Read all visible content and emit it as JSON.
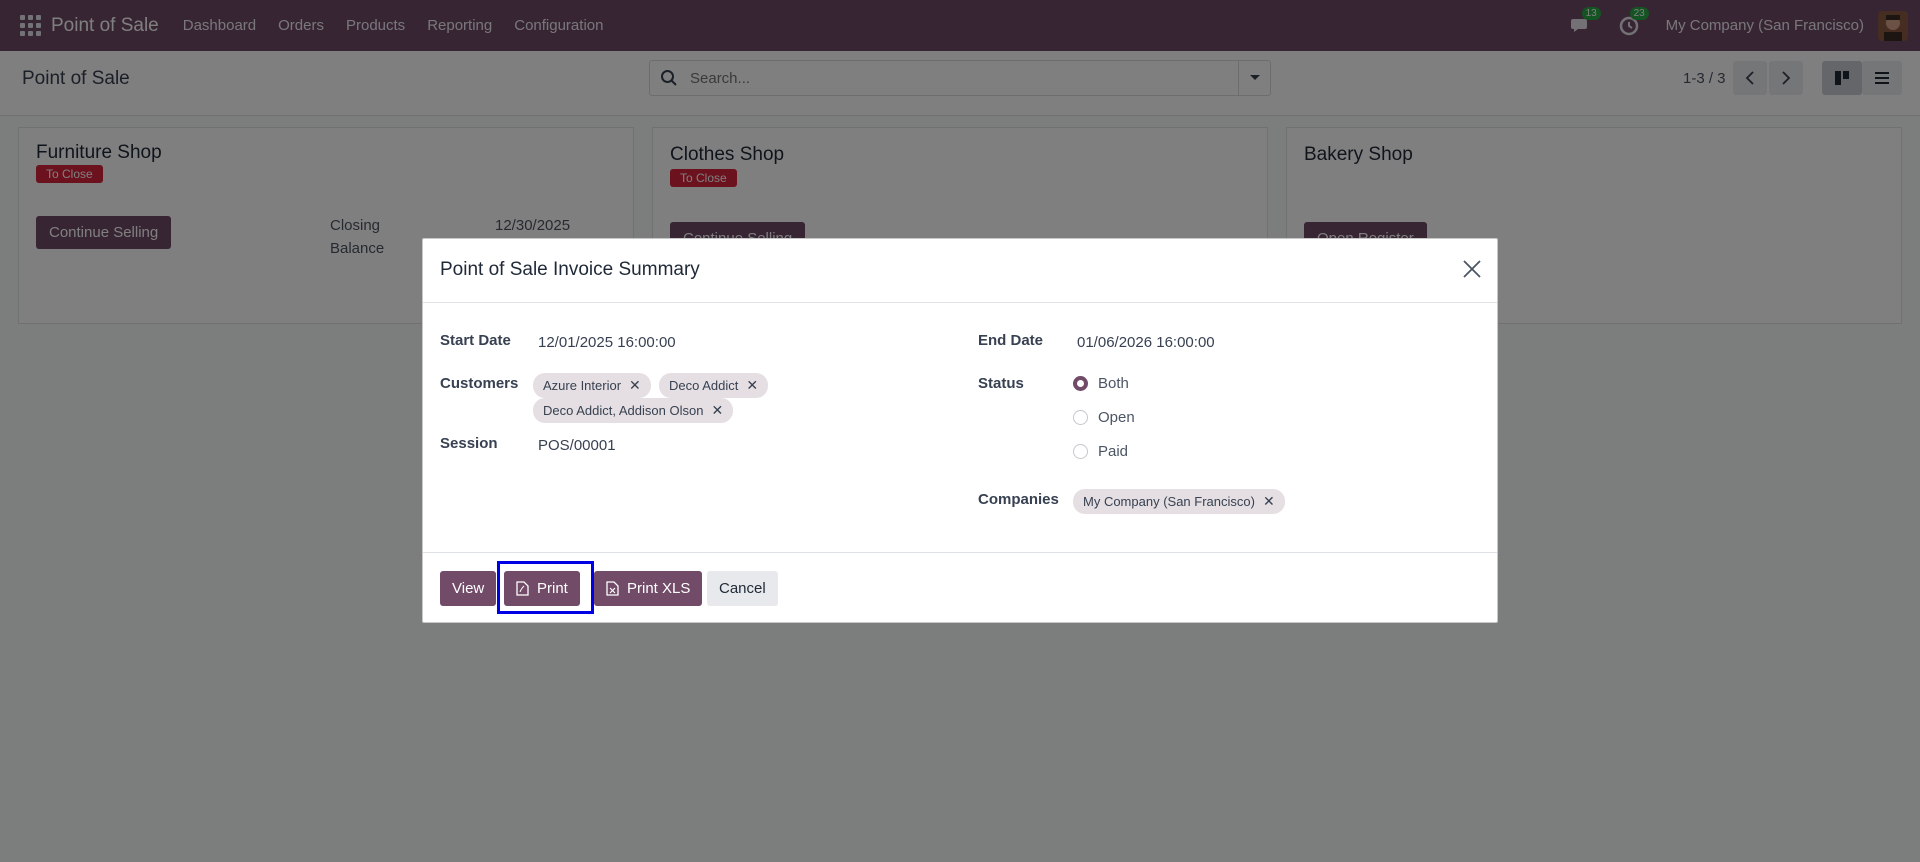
{
  "navbar": {
    "brand": "Point of Sale",
    "menu": [
      "Dashboard",
      "Orders",
      "Products",
      "Reporting",
      "Configuration"
    ],
    "messages_count": "13",
    "activities_count": "23",
    "company": "My Company (San Francisco)"
  },
  "control_panel": {
    "title": "Point of Sale",
    "search_placeholder": "Search...",
    "pager": "1-3 / 3"
  },
  "cards": [
    {
      "title": "Furniture Shop",
      "status": "To Close",
      "button": "Continue Selling",
      "closing_label": "Closing",
      "closing_date": "12/30/2025",
      "balance_label": "Balance"
    },
    {
      "title": "Clothes Shop",
      "status": "To Close",
      "button": "Continue Selling"
    },
    {
      "title": "Bakery Shop",
      "button": "Open Register"
    }
  ],
  "modal": {
    "title": "Point of Sale Invoice Summary",
    "fields": {
      "start_date_label": "Start Date",
      "start_date": "12/01/2025 16:00:00",
      "customers_label": "Customers",
      "customers": [
        "Azure Interior",
        "Deco Addict",
        "Deco Addict, Addison Olson"
      ],
      "session_label": "Session",
      "session": "POS/00001",
      "end_date_label": "End Date",
      "end_date": "01/06/2026 16:00:00",
      "status_label": "Status",
      "status_options": [
        "Both",
        "Open",
        "Paid"
      ],
      "status_selected": "Both",
      "companies_label": "Companies",
      "companies": [
        "My Company (San Francisco)"
      ]
    },
    "buttons": {
      "view": "View",
      "print": "Print",
      "print_xls": "Print XLS",
      "cancel": "Cancel"
    }
  },
  "colors": {
    "brand": "#714b67",
    "danger": "#d9243c",
    "highlight": "#0000e6"
  }
}
